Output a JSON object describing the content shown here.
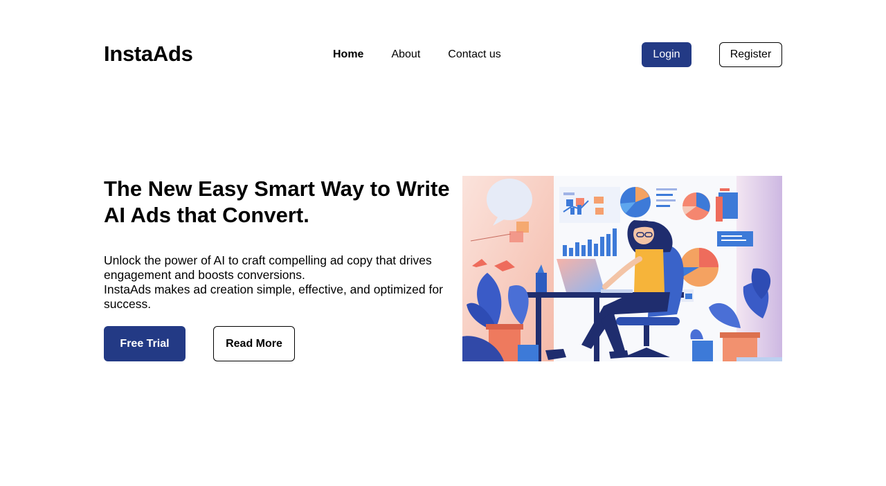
{
  "header": {
    "logo": "InstaAds",
    "nav": [
      {
        "label": "Home",
        "active": true
      },
      {
        "label": "About",
        "active": false
      },
      {
        "label": "Contact us",
        "active": false
      }
    ],
    "login_label": "Login",
    "register_label": "Register"
  },
  "hero": {
    "title": "The New Easy Smart Way to Write AI Ads that Convert.",
    "description_line1": "Unlock the power of AI to craft compelling ad copy that drives engagement and boosts conversions.",
    "description_line2": "InstaAds makes ad creation simple, effective, and optimized for success.",
    "primary_button": "Free Trial",
    "secondary_button": "Read More",
    "illustration_icon": "woman-working-at-laptop-with-charts-illustration"
  },
  "colors": {
    "primary": "#233a85",
    "text": "#000000",
    "background": "#ffffff"
  }
}
